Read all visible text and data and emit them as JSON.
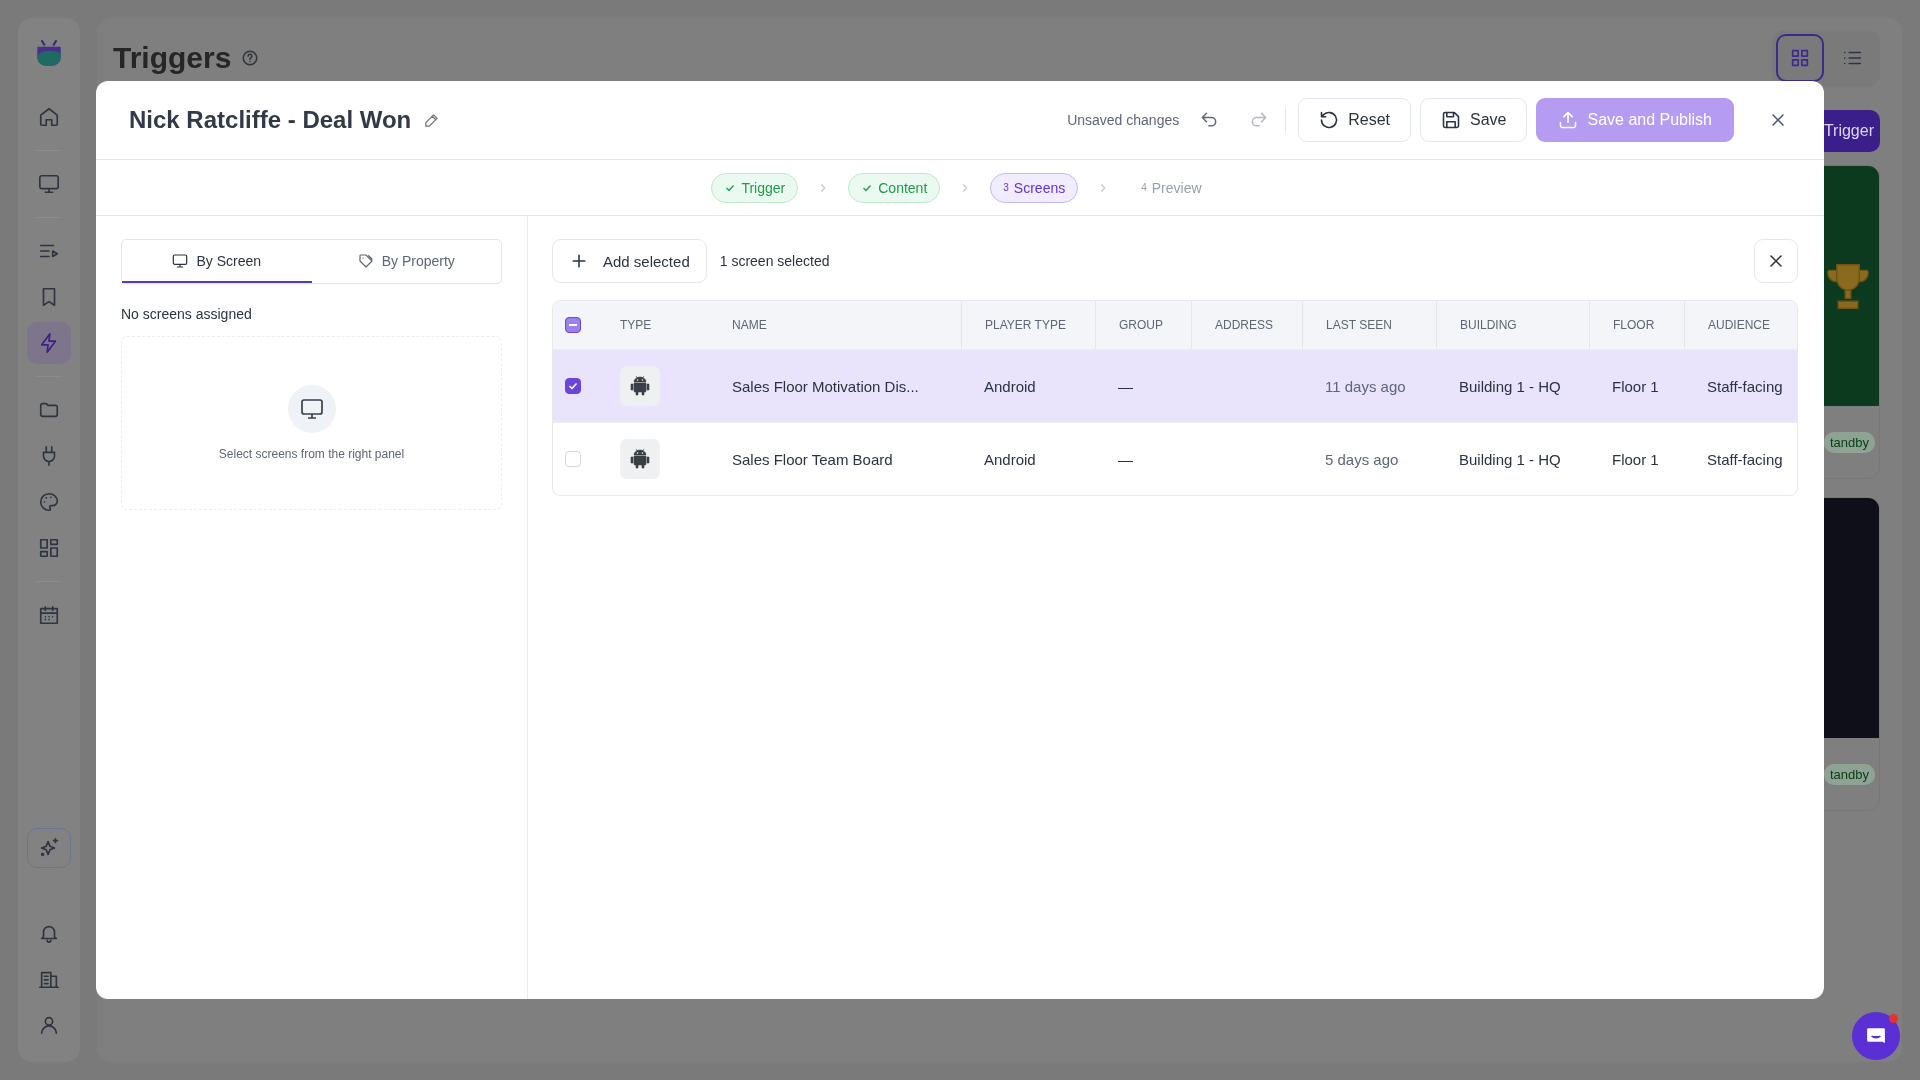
{
  "sidebar": {
    "items": [
      {
        "selected": false
      },
      {
        "selected": false
      },
      {
        "selected": false
      },
      {
        "selected": false
      },
      {
        "selected": true
      },
      {
        "selected": false
      },
      {
        "selected": false
      },
      {
        "selected": false
      },
      {
        "selected": false
      },
      {
        "selected": false
      }
    ]
  },
  "page": {
    "title": "Triggers",
    "views": [
      {
        "selected": true
      },
      {
        "selected": false
      }
    ],
    "new_button": "Trigger",
    "cards": [
      {
        "status": "tandby",
        "kind": "trophy"
      },
      {
        "status": "tandby",
        "kind": "dark"
      }
    ]
  },
  "modal": {
    "title": "Nick Ratcliffe - Deal Won",
    "unsaved": "Unsaved changes",
    "buttons": {
      "reset": "Reset",
      "save": "Save",
      "publish": "Save and Publish"
    },
    "steps": [
      {
        "label": "Trigger",
        "completed": true,
        "current": false
      },
      {
        "label": "Content",
        "completed": true,
        "current": false
      },
      {
        "label": "Screens",
        "number": "3",
        "completed": false,
        "current": true
      },
      {
        "label": "Preview",
        "number": "4",
        "completed": false,
        "current": false
      }
    ],
    "left": {
      "tabs": [
        {
          "label": "By Screen",
          "selected": true
        },
        {
          "label": "By Property",
          "selected": false
        }
      ],
      "note": "No screens assigned",
      "empty_hint": "Select screens from the right panel"
    },
    "right": {
      "add_button": "Add selected",
      "selection_count": "1 screen selected",
      "table": {
        "select_all": {
          "indeterminate": true
        },
        "columns": [
          "TYPE",
          "NAME",
          "PLAYER TYPE",
          "GROUP",
          "ADDRESS",
          "LAST SEEN",
          "BUILDING",
          "FLOOR",
          "AUDIENCE"
        ],
        "rows": [
          {
            "selected": true,
            "name": "Sales Floor Motivation Dis...",
            "player_type": "Android",
            "group": "—",
            "last_seen": "11 days ago",
            "building": "Building 1 - HQ",
            "floor": "Floor 1",
            "audience": "Staff-facing"
          },
          {
            "selected": false,
            "name": "Sales Floor Team Board",
            "player_type": "Android",
            "group": "—",
            "last_seen": "5 days ago",
            "building": "Building 1 - HQ",
            "floor": "Floor 1",
            "audience": "Staff-facing"
          }
        ]
      }
    }
  }
}
